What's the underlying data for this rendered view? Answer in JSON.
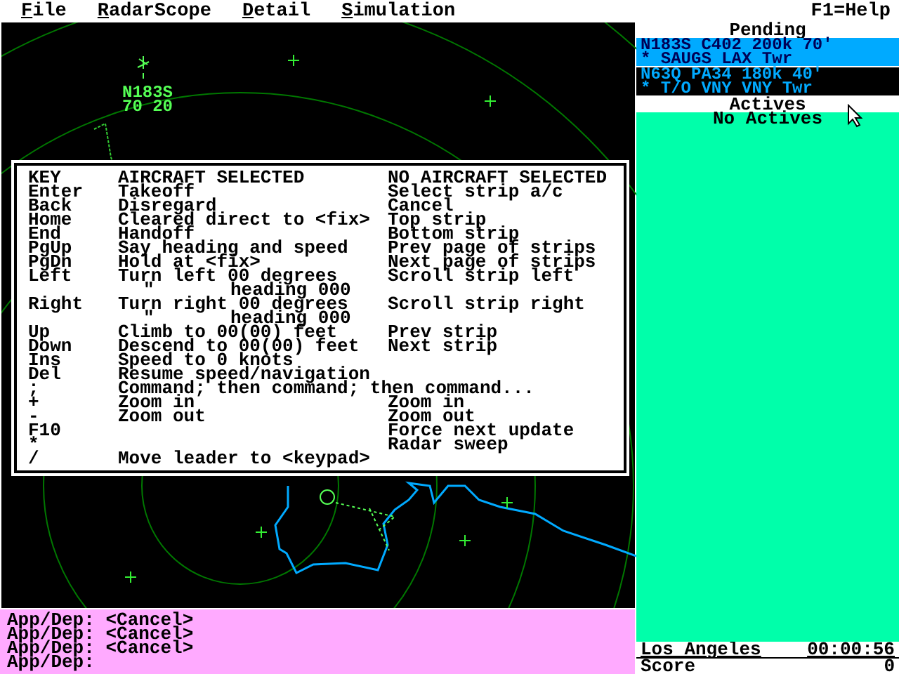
{
  "menu_bar": {
    "items": [
      {
        "label": "File"
      },
      {
        "label": "RadarScope"
      },
      {
        "label": "Detail"
      },
      {
        "label": "Simulation"
      }
    ],
    "help": "F1=Help"
  },
  "radar": {
    "aircraft": [
      {
        "callsign": "N183S",
        "altitude_speed": "70 20"
      }
    ]
  },
  "help_dialog": {
    "headers": {
      "key": "KEY",
      "aircraft": "AIRCRAFT SELECTED",
      "no_aircraft": "NO AIRCRAFT SELECTED"
    },
    "rows": [
      {
        "kind": "command",
        "key": "Enter",
        "aircraft": "Takeoff",
        "no_aircraft": "Select strip a/c"
      },
      {
        "kind": "command",
        "key": "Back",
        "aircraft": "Disregard",
        "no_aircraft": "Cancel"
      },
      {
        "kind": "command",
        "key": "Home",
        "aircraft": "Cleared direct to <fix>",
        "no_aircraft": "Top strip"
      },
      {
        "kind": "command",
        "key": "End",
        "aircraft": "Handoff",
        "no_aircraft": "Bottom strip"
      },
      {
        "kind": "command",
        "key": "PgUp",
        "aircraft": "Say heading and speed",
        "no_aircraft": "Prev page of strips"
      },
      {
        "kind": "command",
        "key": "PgDn",
        "aircraft": "Hold at <fix>",
        "no_aircraft": "Next page of strips"
      },
      {
        "kind": "command",
        "key": "Left",
        "aircraft": "Turn left 00 degrees",
        "no_aircraft": "Scroll strip left"
      },
      {
        "kind": "continuation",
        "ditto": "\"",
        "detail": "heading 000"
      },
      {
        "kind": "command",
        "key": "Right",
        "aircraft": "Turn right 00 degrees",
        "no_aircraft": "Scroll strip right"
      },
      {
        "kind": "continuation",
        "ditto": "\"",
        "detail": "heading 000"
      },
      {
        "kind": "command",
        "key": "Up",
        "aircraft": "Climb to 00(00) feet",
        "no_aircraft": "Prev strip"
      },
      {
        "kind": "command",
        "key": "Down",
        "aircraft": "Descend to 00(00) feet",
        "no_aircraft": "Next strip"
      },
      {
        "kind": "command",
        "key": "Ins",
        "aircraft": "Speed to 0 knots"
      },
      {
        "kind": "command",
        "key": "Del",
        "aircraft": "Resume speed/navigation"
      },
      {
        "kind": "command",
        "key": ";",
        "aircraft": "Command; then command; then command..."
      },
      {
        "kind": "command",
        "key": "+",
        "aircraft": "Zoom in",
        "no_aircraft": "Zoom in"
      },
      {
        "kind": "command",
        "key": "-",
        "aircraft": "Zoom out",
        "no_aircraft": "Zoom out"
      },
      {
        "kind": "command",
        "key": "F10",
        "no_aircraft": "Force next update"
      },
      {
        "kind": "command",
        "key": "*",
        "no_aircraft": "Radar sweep"
      },
      {
        "kind": "command",
        "key": "/",
        "aircraft": "Move leader to <keypad>"
      }
    ]
  },
  "messages": [
    "App/Dep: <Cancel>",
    "App/Dep: <Cancel>",
    "App/Dep: <Cancel>",
    "App/Dep:"
  ],
  "pending": {
    "title": "Pending",
    "strips": [
      {
        "line_1": "N183S C402 200k 70'",
        "line_2": "* SAUGS LAX Twr",
        "selected": true
      },
      {
        "line_1": "N63Q PA34 180k 40'",
        "line_2": "* T/O VNY VNY Twr",
        "selected": false
      }
    ]
  },
  "actives": {
    "title": "Actives",
    "empty_text": "No Actives"
  },
  "status": {
    "location": "Los Angeles",
    "clock": "00:00:56",
    "score_label": "Score",
    "score": "0"
  }
}
